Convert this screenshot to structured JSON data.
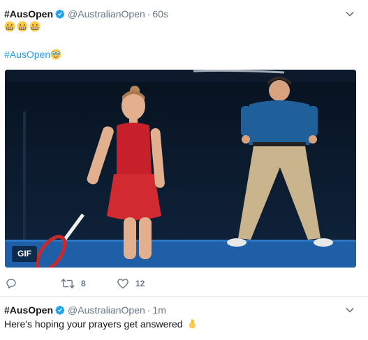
{
  "tweets": [
    {
      "name": "#AusOpen",
      "handle": "@AustralianOpen",
      "separator": "·",
      "time": "60s",
      "emojis": [
        "grimacing-face-emoji",
        "grimacing-face-emoji",
        "grimacing-face-emoji"
      ],
      "hashtag": "#AusOpen",
      "hashtag_emoji": "nerd-face-emoji",
      "media_badge": "GIF",
      "actions": {
        "reply_count": "",
        "retweet_count": "8",
        "like_count": "12"
      }
    },
    {
      "name": "#AusOpen",
      "handle": "@AustralianOpen",
      "separator": "·",
      "time": "1m",
      "text": "Here's hoping your prayers get answered",
      "text_emoji": "crossed-fingers-emoji"
    }
  ],
  "colors": {
    "link": "#1da1f2",
    "muted": "#657786",
    "verified": "#1da1f2"
  }
}
